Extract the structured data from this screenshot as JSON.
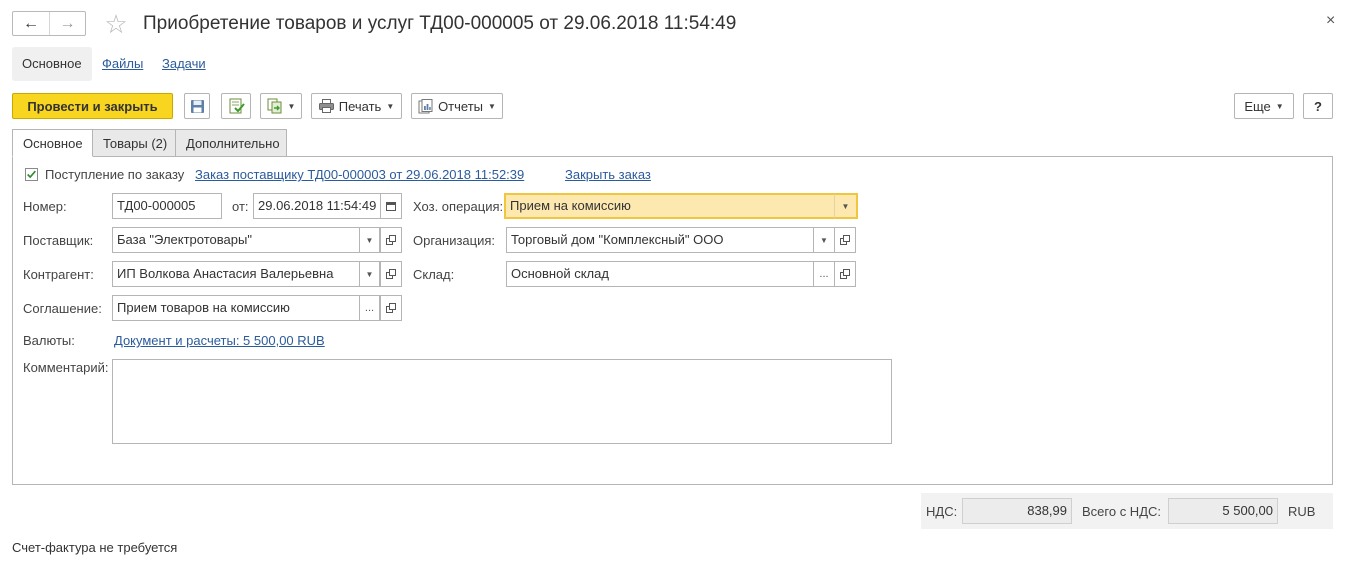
{
  "window": {
    "title": "Приобретение товаров и услуг ТД00-000005 от 29.06.2018 11:54:49",
    "close_glyph": "×",
    "back_glyph": "←",
    "forward_glyph": "→",
    "star_glyph": "☆"
  },
  "sections": {
    "main": "Основное",
    "files": "Файлы",
    "tasks": "Задачи"
  },
  "toolbar": {
    "post_close": "Провести и закрыть",
    "print": "Печать",
    "reports": "Отчеты",
    "more": "Еще",
    "help": "?"
  },
  "tabs": {
    "main": "Основное",
    "goods": "Товары (2)",
    "extra": "Дополнительно"
  },
  "form": {
    "by_order_label": "Поступление по заказу",
    "by_order_checked": true,
    "order_link": "Заказ поставщику ТД00-000003 от 29.06.2018 11:52:39",
    "close_order_link": "Закрыть заказ",
    "number_label": "Номер:",
    "number_value": "ТД00-000005",
    "date_label": "от:",
    "date_value": "29.06.2018 11:54:49",
    "operation_label": "Хоз. операция:",
    "operation_value": "Прием на комиссию",
    "supplier_label": "Поставщик:",
    "supplier_value": "База \"Электротовары\"",
    "org_label": "Организация:",
    "org_value": "Торговый дом \"Комплексный\" ООО",
    "counterparty_label": "Контрагент:",
    "counterparty_value": "ИП Волкова Анастасия Валерьевна",
    "warehouse_label": "Склад:",
    "warehouse_value": "Основной склад",
    "agreement_label": "Соглашение:",
    "agreement_value": "Прием товаров на комиссию",
    "currency_label": "Валюты:",
    "currency_link": "Документ и расчеты: 5 500,00 RUB",
    "comment_label": "Комментарий:",
    "comment_value": "",
    "ellipsis": "..."
  },
  "totals": {
    "vat_label": "НДС:",
    "vat_value": "838,99",
    "total_label": "Всего с НДС:",
    "total_value": "5 500,00",
    "currency": "RUB"
  },
  "footer": {
    "invoice_status": "Счет-фактура не требуется"
  },
  "colors": {
    "accent_yellow": "#f8d51f",
    "link_blue": "#2b5b9c",
    "highlight_field": "#fde9b0"
  }
}
